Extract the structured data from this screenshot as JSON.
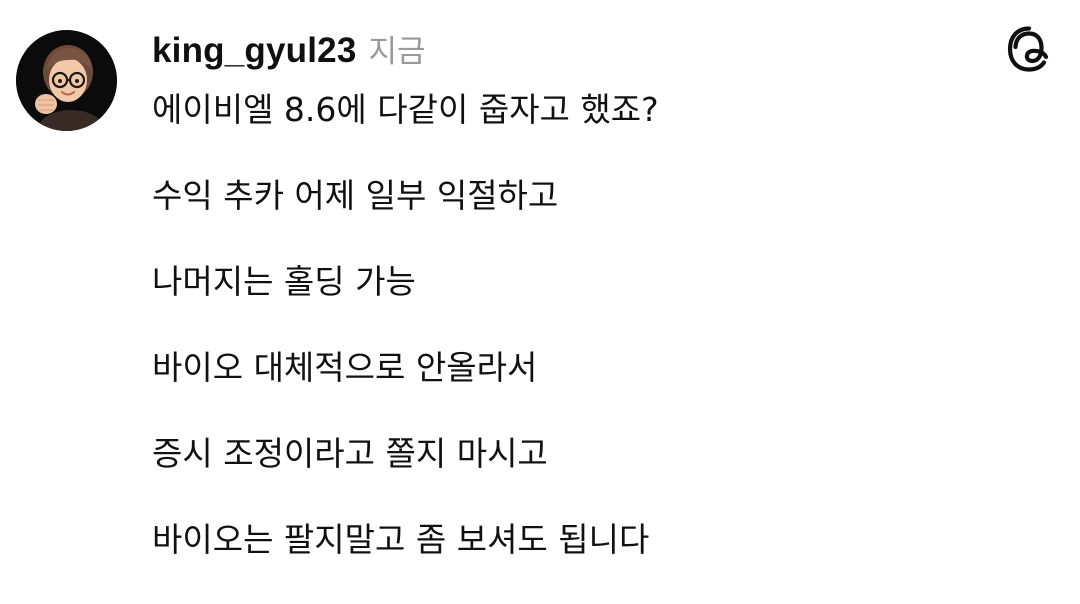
{
  "post": {
    "username": "king_gyul23",
    "timestamp": "지금",
    "lines": [
      "에이비엘 8.6에 다같이 줍자고 했죠?",
      "수익 추카 어제 일부 익절하고",
      "나머지는 홀딩 가능",
      "바이오 대체적으로 안올라서",
      "증시 조정이라고 쫄지 마시고",
      "바이오는 팔지말고 좀 보셔도 됩니다"
    ]
  },
  "icons": {
    "avatar": "memoji-avatar",
    "brand": "threads-logo-icon"
  },
  "colors": {
    "text": "#101010",
    "timestamp": "#9a9a9a",
    "background": "#ffffff"
  }
}
